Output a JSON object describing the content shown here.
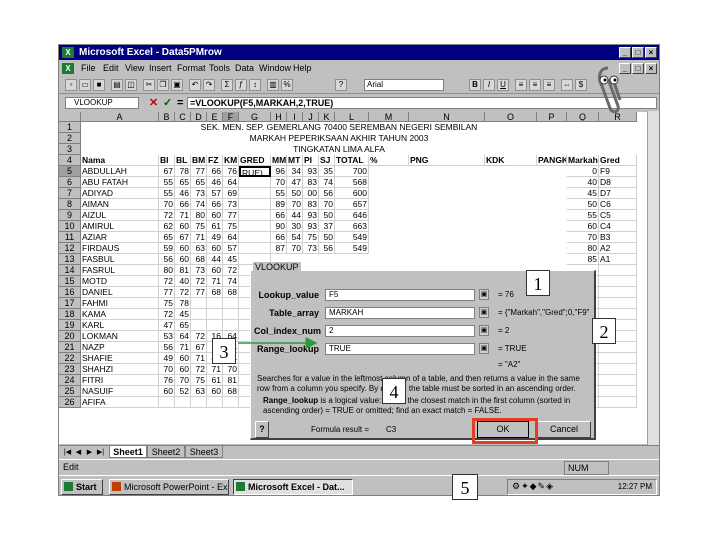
{
  "window": {
    "title": "Microsoft Excel - Data5PMrow",
    "buttons": [
      "_",
      "□",
      "×"
    ]
  },
  "menu": [
    "File",
    "Edit",
    "View",
    "Insert",
    "Format",
    "Tools",
    "Data",
    "Window",
    "Help"
  ],
  "toolbar": {
    "font_box": "Arial",
    "zoom_box": ""
  },
  "formula_bar": {
    "name_box": "VLOOKUP",
    "fx_cancel": "✕",
    "fx_enter": "✓",
    "fx_eq": "=",
    "formula": "=VLOOKUP(F5,MARKAH,2,TRUE)"
  },
  "columns": [
    "A",
    "B",
    "C",
    "D",
    "E",
    "F",
    "G",
    "H",
    "I",
    "J",
    "K",
    "L",
    "M",
    "N",
    "O",
    "P",
    "Q",
    "R"
  ],
  "headings": {
    "line1": "SEK. MEN. SEP. GEMERLANG 70400 SEREMBAN NEGERI SEMBILAN",
    "line2": "MARKAH PEPERIKSAAN AKHIR TAHUN 2003",
    "line3": "TINGKATAN LIMA ALFA"
  },
  "table_header": [
    "Nama",
    "BI",
    "BL",
    "BM",
    "FZ",
    "KM",
    "GRED",
    "MM",
    "MT",
    "PI",
    "SJ",
    "TOTAL",
    "%",
    "PNG",
    "KDK",
    "PANGKAT",
    "Markah",
    "Gred"
  ],
  "rows": [
    {
      "n": "5",
      "name": "ABDULLAH",
      "v": [
        "67",
        "78",
        "77",
        "66",
        "76"
      ],
      "gred": "RUE)",
      "rest": [
        "96",
        "34",
        "93",
        "35",
        "700"
      ],
      "extra": "0",
      "gred2": "F9"
    },
    {
      "n": "6",
      "name": "ABU FATAH",
      "v": [
        "55",
        "65",
        "65",
        "46",
        "64"
      ],
      "gred": "",
      "rest": [
        "70",
        "47",
        "83",
        "74",
        "568"
      ],
      "extra": "40",
      "gred2": "D8"
    },
    {
      "n": "7",
      "name": "ADIYAD",
      "v": [
        "55",
        "46",
        "73",
        "57",
        "69"
      ],
      "gred": "",
      "rest": [
        "55",
        "50",
        "00",
        "56",
        "600"
      ],
      "extra": "45",
      "gred2": "D7"
    },
    {
      "n": "8",
      "name": "AIMAN",
      "v": [
        "70",
        "66",
        "74",
        "66",
        "73"
      ],
      "gred": "",
      "rest": [
        "89",
        "70",
        "83",
        "70",
        "657"
      ],
      "extra": "50",
      "gred2": "C6"
    },
    {
      "n": "9",
      "name": "AIZUL",
      "v": [
        "72",
        "71",
        "80",
        "60",
        "77"
      ],
      "gred": "",
      "rest": [
        "66",
        "44",
        "93",
        "50",
        "646"
      ],
      "extra": "55",
      "gred2": "C5"
    },
    {
      "n": "10",
      "name": "AMIRUL",
      "v": [
        "62",
        "60",
        "75",
        "61",
        "75"
      ],
      "gred": "",
      "rest": [
        "90",
        "30",
        "93",
        "37",
        "663"
      ],
      "extra": "60",
      "gred2": "C4"
    },
    {
      "n": "11",
      "name": "AZIAR",
      "v": [
        "65",
        "67",
        "71",
        "49",
        "64"
      ],
      "gred": "",
      "rest": [
        "66",
        "54",
        "75",
        "50",
        "549"
      ],
      "extra": "70",
      "gred2": "B3"
    },
    {
      "n": "12",
      "name": "FIRDAUS",
      "v": [
        "59",
        "60",
        "63",
        "60",
        "57"
      ],
      "gred": "",
      "rest": [
        "87",
        "70",
        "73",
        "56",
        "549"
      ],
      "extra": "80",
      "gred2": "A2"
    },
    {
      "n": "13",
      "name": "FASBUL",
      "v": [
        "56",
        "60",
        "68",
        "44",
        "45"
      ],
      "gred": "",
      "rest": [],
      "extra": "85",
      "gred2": "A1"
    },
    {
      "n": "14",
      "name": "FASRUL",
      "v": [
        "80",
        "81",
        "73",
        "60",
        "72"
      ],
      "gred": "",
      "rest": [],
      "extra": "",
      "gred2": ""
    },
    {
      "n": "15",
      "name": "MOTD",
      "v": [
        "72",
        "40",
        "72",
        "71",
        "74"
      ],
      "gred": "",
      "rest": [],
      "extra": "",
      "gred2": ""
    },
    {
      "n": "16",
      "name": "DANIEL",
      "v": [
        "77",
        "72",
        "77",
        "68",
        "68"
      ],
      "gred": "",
      "rest": [],
      "extra": "",
      "gred2": ""
    },
    {
      "n": "17",
      "name": "FAHMI",
      "v": [
        "75",
        "78",
        "",
        "",
        ""
      ],
      "gred": "",
      "rest": [],
      "extra": "",
      "gred2": ""
    },
    {
      "n": "18",
      "name": "KAMA",
      "v": [
        "72",
        "45",
        "",
        "",
        ""
      ],
      "gred": "",
      "rest": [],
      "extra": "",
      "gred2": ""
    },
    {
      "n": "19",
      "name": "KARL",
      "v": [
        "47",
        "65",
        "",
        "",
        ""
      ],
      "gred": "",
      "rest": [],
      "extra": "",
      "gred2": ""
    },
    {
      "n": "20",
      "name": "LOKMAN",
      "v": [
        "53",
        "64",
        "72",
        "16",
        "64"
      ],
      "gred": "",
      "rest": [],
      "extra": "",
      "gred2": ""
    },
    {
      "n": "21",
      "name": "NAZP",
      "v": [
        "56",
        "71",
        "67",
        "62",
        "74"
      ],
      "gred": "",
      "rest": [],
      "extra": "",
      "gred2": ""
    },
    {
      "n": "22",
      "name": "SHAFIE",
      "v": [
        "49",
        "60",
        "71",
        "46",
        "64"
      ],
      "gred": "",
      "rest": [],
      "extra": "",
      "gred2": ""
    },
    {
      "n": "23",
      "name": "SHAHZI",
      "v": [
        "70",
        "60",
        "72",
        "71",
        "70"
      ],
      "gred": "",
      "rest": [],
      "extra": "",
      "gred2": ""
    },
    {
      "n": "24",
      "name": "FITRI",
      "v": [
        "76",
        "70",
        "75",
        "61",
        "81"
      ],
      "gred": "",
      "rest": [],
      "extra": "",
      "gred2": ""
    },
    {
      "n": "25",
      "name": "NASUIF",
      "v": [
        "60",
        "52",
        "63",
        "60",
        "68"
      ],
      "gred": "",
      "rest": [],
      "extra": "",
      "gred2": ""
    },
    {
      "n": "26",
      "name": "AFIFA",
      "v": [
        "",
        "",
        "",
        "",
        ""
      ],
      "gred": "",
      "rest": [],
      "extra": "",
      "gred2": ""
    }
  ],
  "sheets": [
    "Sheet1",
    "Sheet2",
    "Sheet3"
  ],
  "status": {
    "left": "Edit",
    "right": "NUM"
  },
  "taskbar": {
    "start": "Start",
    "tasks": [
      "Microsoft PowerPoint - Ex...",
      "Microsoft Excel - Dat..."
    ],
    "clock": "12:27 PM"
  },
  "dialog": {
    "title": "VLOOKUP",
    "args": [
      {
        "label": "Lookup_value",
        "value": "F5",
        "result": "= 76"
      },
      {
        "label": "Table_array",
        "value": "MARKAH",
        "result": "= {\"Markah\",\"Gred\";0,\"F9\""
      },
      {
        "label": "Col_index_num",
        "value": "2",
        "result": "= 2"
      },
      {
        "label": "Range_lookup",
        "value": "TRUE",
        "result": "= TRUE"
      }
    ],
    "after_result": "= \"A2\"",
    "description": "Searches for a value in the leftmost column of a table, and then returns a value in the same row from a column you specify. By default, the table must be sorted in an ascending order.",
    "range_desc_label": "Range_lookup",
    "range_desc": "is a logical value: to find the closest match in the first column (sorted in ascending order) = TRUE or omitted; find an exact match = FALSE.",
    "formula_result_label": "Formula result =",
    "formula_result": "C3",
    "ok": "OK",
    "cancel": "Cancel",
    "help": "?"
  },
  "callouts": [
    "1",
    "2",
    "3",
    "4",
    "5"
  ],
  "colors": {
    "titlebar": "#000080",
    "callout_box": "#e04020",
    "arrow": "#2a9a3a"
  }
}
